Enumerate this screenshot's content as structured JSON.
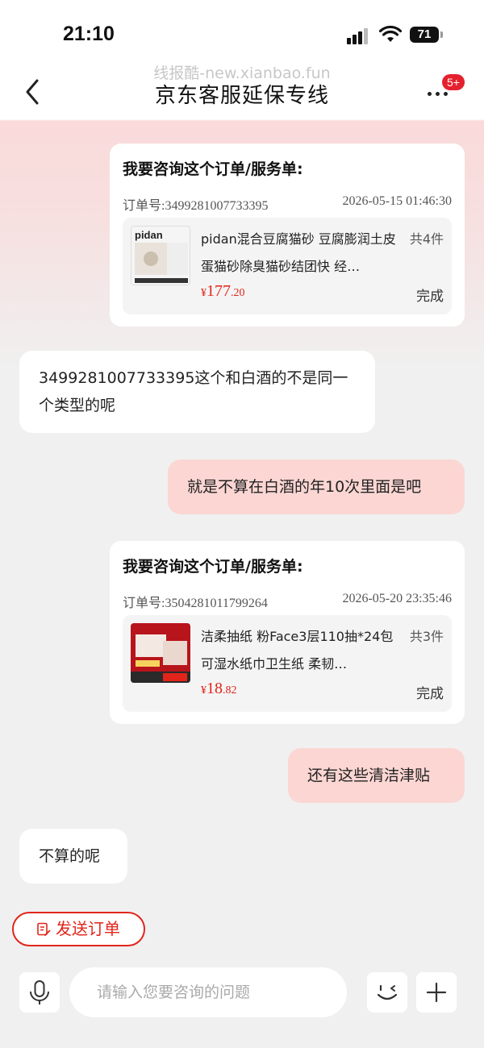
{
  "status_bar": {
    "time": "21:10",
    "battery": "71"
  },
  "watermark": "线报酷-new.xianbao.fun",
  "nav": {
    "title": "京东客服延保专线",
    "badge": "5+"
  },
  "messages": {
    "card1": {
      "title": "我要咨询这个订单/服务单:",
      "order_no": "订单号:3499281007733395",
      "time": "2026-05-15 01:46:30",
      "product_name": "pidan混合豆腐猫砂 豆腐膨润土皮蛋猫砂除臭猫砂结团快 经…",
      "count": "共4件",
      "price_symbol": "¥",
      "price_int": "177",
      "price_dec": ".20",
      "status": "完成",
      "thumb_text": "pidan"
    },
    "msg2": "3499281007733395这个和白酒的不是同一个类型的呢",
    "msg3": "就是不算在白酒的年10次里面是吧",
    "card2": {
      "title": "我要咨询这个订单/服务单:",
      "order_no": "订单号:3504281011799264",
      "time": "2026-05-20 23:35:46",
      "product_name": "洁柔抽纸 粉Face3层110抽*24包 可湿水纸巾卫生纸 柔韧…",
      "count": "共3件",
      "price_symbol": "¥",
      "price_int": "18",
      "price_dec": ".82",
      "status": "完成"
    },
    "msg5": "还有这些清洁津贴",
    "msg6": "不算的呢"
  },
  "send_order_label": "发送订单",
  "input": {
    "placeholder": "请输入您要咨询的问题"
  },
  "colors": {
    "accent": "#e1251b",
    "right_bubble": "#fbd6d3",
    "background": "#f0f0f0"
  }
}
